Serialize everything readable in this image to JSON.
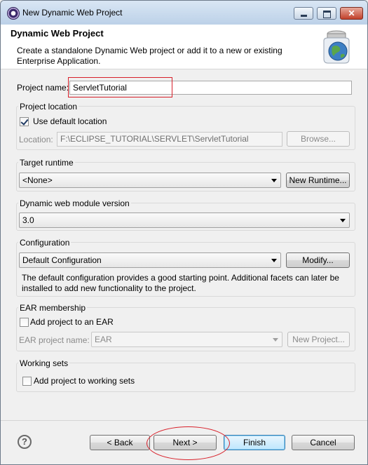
{
  "window": {
    "title": "New Dynamic Web Project"
  },
  "header": {
    "title": "Dynamic Web Project",
    "description": "Create a standalone Dynamic Web project or add it to a new or existing Enterprise Application.",
    "banner_icon": "globe-jar-icon"
  },
  "project_name": {
    "label": "Project name:",
    "value": "ServletTutorial"
  },
  "project_location": {
    "group_title": "Project location",
    "use_default_label": "Use default location",
    "use_default_checked": true,
    "location_label": "Location:",
    "location_value": "F:\\ECLIPSE_TUTORIAL\\SERVLET\\ServletTutorial",
    "browse_label": "Browse..."
  },
  "target_runtime": {
    "group_title": "Target runtime",
    "selected": "<None>",
    "new_runtime_label": "New Runtime..."
  },
  "module_version": {
    "group_title": "Dynamic web module version",
    "selected": "3.0"
  },
  "configuration": {
    "group_title": "Configuration",
    "selected": "Default Configuration",
    "modify_label": "Modify...",
    "description": "The default configuration provides a good starting point. Additional facets can later be installed to add new functionality to the project."
  },
  "ear": {
    "group_title": "EAR membership",
    "add_label": "Add project to an EAR",
    "add_checked": false,
    "name_label": "EAR project name:",
    "name_value": "EAR",
    "new_project_label": "New Project..."
  },
  "working_sets": {
    "group_title": "Working sets",
    "add_label": "Add project to working sets",
    "add_checked": false
  },
  "footer": {
    "help_symbol": "?",
    "back_label": "< Back",
    "next_label": "Next >",
    "finish_label": "Finish",
    "cancel_label": "Cancel"
  },
  "colors": {
    "annotation": "#d8202a",
    "title_bar": "#bcd1e8"
  }
}
